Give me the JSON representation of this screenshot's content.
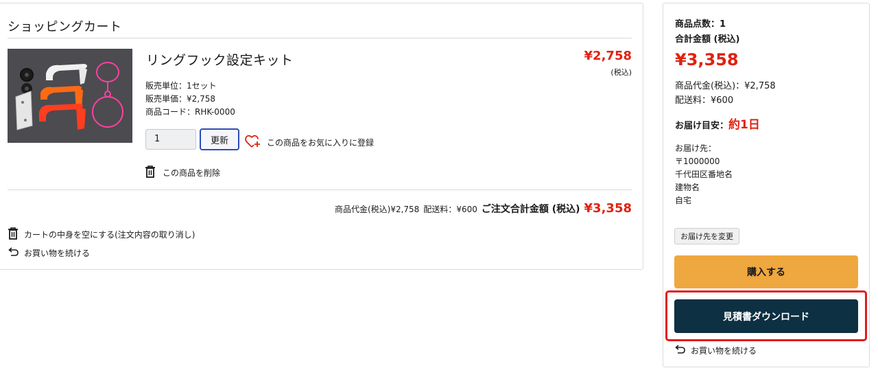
{
  "cart": {
    "title": "ショッピングカート",
    "item": {
      "name": "リングフック設定キット",
      "price": "¥2,758",
      "tax_note": "(税込)",
      "unit": "販売単位：1セット",
      "unit_price": "販売単価：¥2,758",
      "code": "商品コード：RHK-0000",
      "quantity": "1",
      "update_label": "更新",
      "favorite_label": "この商品をお気に入りに登録",
      "delete_label": "この商品を削除"
    },
    "summary": {
      "subtotal": "商品代金(税込)¥2,758",
      "shipping": "配送料：¥600",
      "total_label": "ご注文合計金額 (税込)",
      "total": "¥3,358"
    },
    "empty_cart_label": "カートの中身を空にする(注文内容の取り消し)",
    "continue_label": "お買い物を続ける"
  },
  "side": {
    "item_count": "商品点数：1",
    "total_label": "合計金額 (税込)",
    "total": "¥3,358",
    "subtotal": "商品代金(税込)：¥2,758",
    "shipping": "配送料：¥600",
    "eta_label": "お届け目安：",
    "eta_value": "約1日",
    "address_label": "お届け先：",
    "address_zip": "〒1000000",
    "address_line1": "千代田区番地名",
    "address_line2": "建物名",
    "address_line3": "自宅",
    "change_address_label": "お届け先を変更",
    "buy_label": "購入する",
    "quote_label": "見積書ダウンロード",
    "continue_label": "お買い物を続ける"
  },
  "colors": {
    "price_red": "#e0220f",
    "buy_button": "#efa73f",
    "quote_button": "#0d3042",
    "highlight_border": "#e31a1a",
    "update_border": "#2a4fb5"
  }
}
